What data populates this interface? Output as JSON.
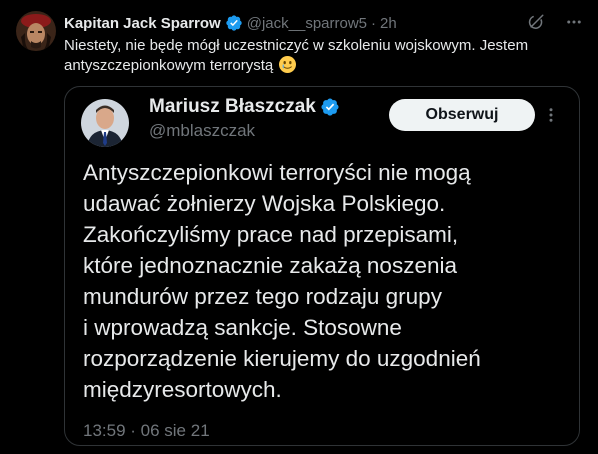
{
  "tweet": {
    "author_name": "Kapitan Jack Sparrow",
    "author_handle": "@jack__sparrow5",
    "separator": "·",
    "time": "2h",
    "text": "Niestety, nie będę mógł uczestniczyć w szkoleniu wojskowym. Jestem antyszczepionkowym terrorystą",
    "emoji": "sad-smiling-face-emoji"
  },
  "quoted_tweet": {
    "author_name": "Mariusz Błaszczak",
    "author_handle": "@mblaszczak",
    "follow_label": "Obserwuj",
    "text_lines": [
      "Antyszczepionkowi terroryści nie mogą",
      "udawać żołnierzy Wojska Polskiego.",
      "Zakończyliśmy prace nad przepisami,",
      "które jednoznacznie zakażą noszenia",
      "mundurów przez tego rodzaju grupy",
      "i wprowadzą sankcje. Stosowne",
      "rozporządzenie kierujemy do uzgodnień",
      "międzyresortowych."
    ],
    "timestamp": "13:59 · 06 sie 21"
  },
  "icons": [
    "verified-badge-icon",
    "grok-icon",
    "more-icon"
  ],
  "colors": {
    "background": "#000000",
    "text": "#e7e9ea",
    "secondary_text": "#71767b",
    "verified": "#1d9bf0",
    "border": "#2f3336",
    "follow_button_bg": "#eff3f4"
  }
}
